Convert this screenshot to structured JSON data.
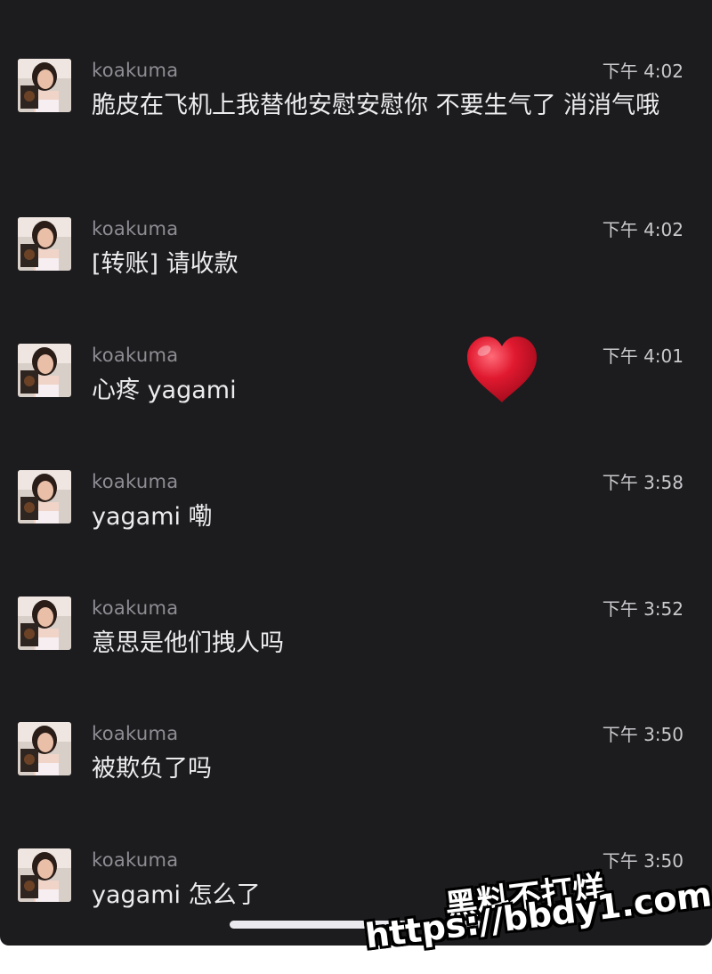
{
  "colors": {
    "background": "#1c1c1e",
    "username": "#8d8d93",
    "time": "#c9c9cd",
    "message_text": "#ececef",
    "heart": "#e0192f"
  },
  "heart_icon": "red-heart-icon",
  "messages": [
    {
      "user": "koakuma",
      "time": "下午 4:02",
      "text": "脆皮在飞机上我替他安慰安慰你 不要生气了 消消气哦"
    },
    {
      "user": "koakuma",
      "time": "下午 4:02",
      "text": "[转账] 请收款"
    },
    {
      "user": "koakuma",
      "time": "下午 4:01",
      "text": "心疼 yagami"
    },
    {
      "user": "koakuma",
      "time": "下午 3:58",
      "text": "yagami 嘞"
    },
    {
      "user": "koakuma",
      "time": "下午 3:52",
      "text": "意思是他们拽人吗"
    },
    {
      "user": "koakuma",
      "time": "下午 3:50",
      "text": "被欺负了吗"
    },
    {
      "user": "koakuma",
      "time": "下午 3:50",
      "text": "yagami 怎么了"
    }
  ],
  "watermark": {
    "title": "黑料不打烊",
    "url": "https://bbdy1.com"
  }
}
